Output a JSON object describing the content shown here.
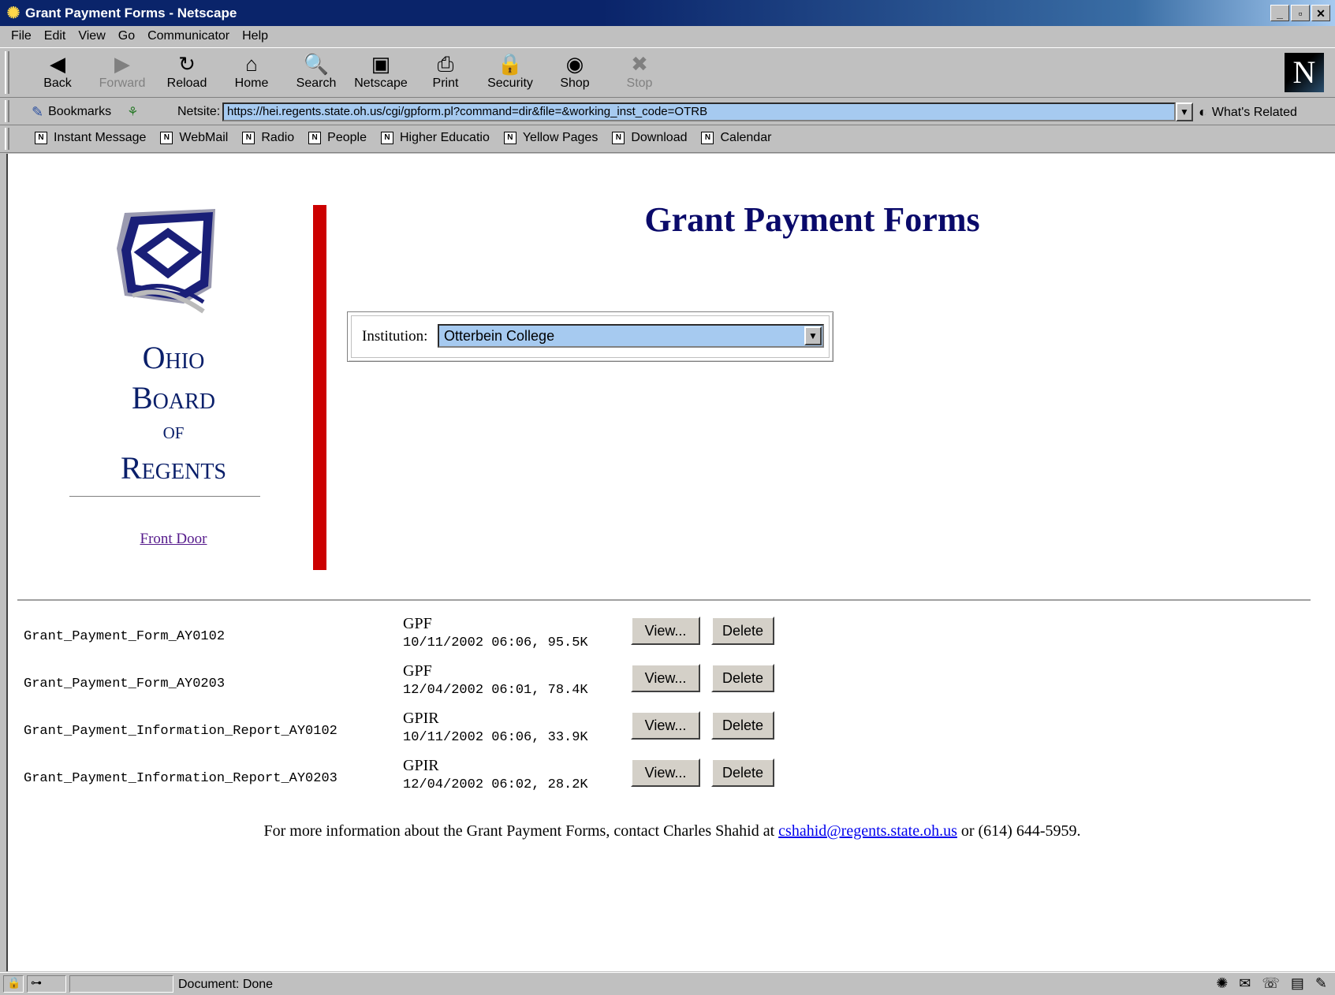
{
  "window": {
    "title": "Grant Payment Forms - Netscape"
  },
  "menu": [
    "File",
    "Edit",
    "View",
    "Go",
    "Communicator",
    "Help"
  ],
  "toolbar": [
    {
      "label": "Back",
      "icon": "back-arrow-icon",
      "glyph": "◀",
      "enabled": true
    },
    {
      "label": "Forward",
      "icon": "forward-arrow-icon",
      "glyph": "▶",
      "enabled": false
    },
    {
      "label": "Reload",
      "icon": "reload-icon",
      "glyph": "↻",
      "enabled": true
    },
    {
      "label": "Home",
      "icon": "home-icon",
      "glyph": "⌂",
      "enabled": true
    },
    {
      "label": "Search",
      "icon": "search-icon",
      "glyph": "🔍",
      "enabled": true
    },
    {
      "label": "Netscape",
      "icon": "my-netscape-icon",
      "glyph": "▣",
      "enabled": true
    },
    {
      "label": "Print",
      "icon": "print-icon",
      "glyph": "⎙",
      "enabled": true
    },
    {
      "label": "Security",
      "icon": "lock-icon",
      "glyph": "🔒",
      "enabled": true
    },
    {
      "label": "Shop",
      "icon": "shop-icon",
      "glyph": "◉",
      "enabled": true
    },
    {
      "label": "Stop",
      "icon": "stop-icon",
      "glyph": "✖",
      "enabled": false
    }
  ],
  "location": {
    "bookmarks_label": "Bookmarks",
    "netsite_label": "Netsite:",
    "url": "https://hei.regents.state.oh.us/cgi/gpform.pl?command=dir&file=&working_inst_code=OTRB",
    "related_label": "What's Related"
  },
  "personal_toolbar": [
    "Instant Message",
    "WebMail",
    "Radio",
    "People",
    "Higher Educatio",
    "Yellow Pages",
    "Download",
    "Calendar"
  ],
  "sidebar": {
    "org_lines": [
      "Ohio",
      "Board",
      "of",
      "Regents"
    ],
    "front_door": "Front Door"
  },
  "main": {
    "title": "Grant Payment Forms",
    "institution_label": "Institution:",
    "institution_value": "Otterbein College"
  },
  "files": [
    {
      "name": "Grant_Payment_Form_AY0102",
      "type": "GPF",
      "meta": "10/11/2002 06:06, 95.5K"
    },
    {
      "name": "Grant_Payment_Form_AY0203",
      "type": "GPF",
      "meta": "12/04/2002 06:01, 78.4K"
    },
    {
      "name": "Grant_Payment_Information_Report_AY0102",
      "type": "GPIR",
      "meta": "10/11/2002 06:06, 33.9K"
    },
    {
      "name": "Grant_Payment_Information_Report_AY0203",
      "type": "GPIR",
      "meta": "12/04/2002 06:02, 28.2K"
    }
  ],
  "file_buttons": {
    "view": "View...",
    "delete": "Delete"
  },
  "footer": {
    "prefix": "For more information about the Grant Payment Forms, contact Charles Shahid at ",
    "email": "cshahid@regents.state.oh.us",
    "suffix": " or (614) 644-5959."
  },
  "status": {
    "text": "Document: Done"
  },
  "colors": {
    "title_blue": "#0a246a",
    "url_highlight": "#a6caf0",
    "red_bar": "#cc0000",
    "heading_navy": "#0a0a6a"
  }
}
